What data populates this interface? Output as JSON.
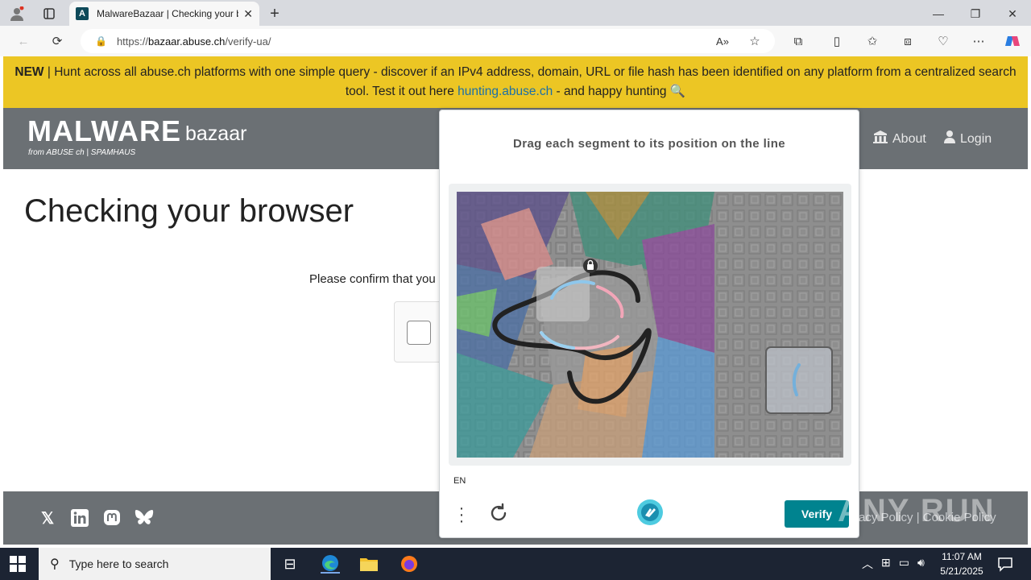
{
  "browser": {
    "tab_title": "MalwareBazaar | Checking your browser",
    "tab_favicon": "A",
    "url_prefix": "https://",
    "url_host": "bazaar.abuse.ch",
    "url_path": "/verify-ua/"
  },
  "banner": {
    "new_label": "NEW",
    "text_before": " | Hunt across all abuse.ch platforms with one simple query - discover if an IPv4 address, domain, URL or file hash has been identified on any platform from a centralized search tool. Test it out here ",
    "link_text": "hunting.abuse.ch",
    "text_after": " - and happy hunting 🔍"
  },
  "header": {
    "logo_main": "MALWARE",
    "logo_sub": "bazaar",
    "logo_from": "from ABUSE ch | SPAMHAUS",
    "nav_about": "About",
    "nav_login": "Login"
  },
  "page": {
    "heading": "Checking your browser",
    "confirm_text": "Please confirm that you"
  },
  "footer": {
    "links": "acy Policy  |  Cookie Policy"
  },
  "captcha": {
    "title": "Drag each segment to its position on the line",
    "lang": "EN",
    "verify_label": "Verify"
  },
  "watermark": "ANY RUN",
  "taskbar": {
    "search_placeholder": "Type here to search",
    "time": "11:07 AM",
    "date": "5/21/2025"
  }
}
